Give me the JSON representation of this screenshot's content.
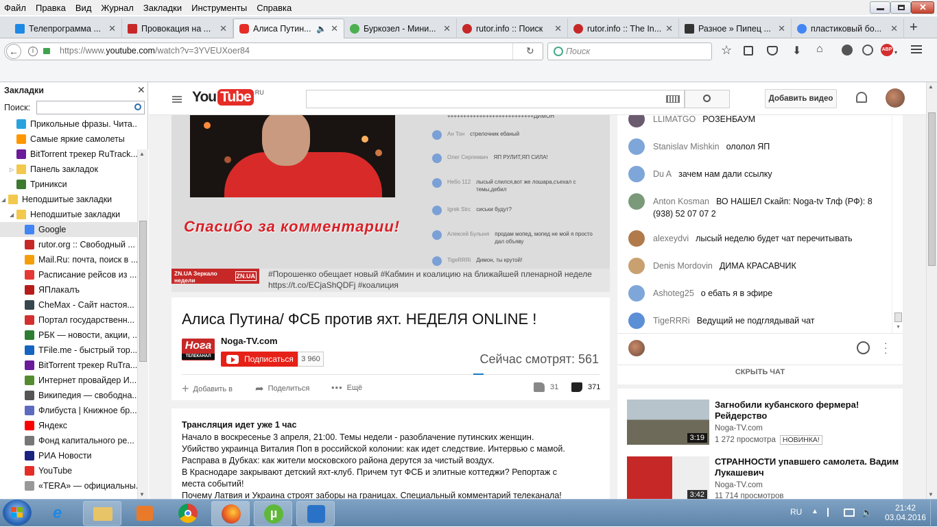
{
  "menu": [
    "Файл",
    "Правка",
    "Вид",
    "Журнал",
    "Закладки",
    "Инструменты",
    "Справка"
  ],
  "tabs": [
    {
      "label": "Телепрограмма ...",
      "favicon_color": "#1e88e5"
    },
    {
      "label": "Провокация на ...",
      "favicon_color": "#c62828"
    },
    {
      "label": "Алиса Путин...",
      "favicon_color": "#e52d27",
      "active": true
    },
    {
      "label": "Буркозел - Мини...",
      "favicon_color": "#4caf50"
    },
    {
      "label": "rutor.info :: Поиск",
      "favicon_color": "#c62828"
    },
    {
      "label": "rutor.info :: The In...",
      "favicon_color": "#c62828"
    },
    {
      "label": "Разное » Пипец ...",
      "favicon_color": "#333333"
    },
    {
      "label": "пластиковый бо...",
      "favicon_color": "#4285f4"
    }
  ],
  "url": {
    "prefix": "https://www.",
    "host": "youtube.com",
    "path": "/watch?v=3YVEUXoer84"
  },
  "search_placeholder": "Поиск",
  "sidebar": {
    "title": "Закладки",
    "search_label": "Поиск:",
    "items": [
      {
        "label": "Прикольные фразы. Чита...",
        "color": "#29a3e0",
        "indent": 24
      },
      {
        "label": "Самые яркие самолеты",
        "color": "#ff9800",
        "indent": 24
      },
      {
        "label": "BitTorrent трекер RuTrack...",
        "color": "#6a1b9a",
        "indent": 24
      },
      {
        "label": "Панель закладок",
        "color": "#f2c94c",
        "indent": 24,
        "folder": true
      },
      {
        "label": "Триникси",
        "color": "#3c7a2e",
        "indent": 24
      },
      {
        "label": "Неподшитые закладки",
        "color": "#f2c94c",
        "indent": 12,
        "folder": true
      },
      {
        "label": "Неподшитые закладки",
        "color": "#f2c94c",
        "indent": 24,
        "folder": true
      },
      {
        "label": "Google",
        "color": "#4285f4",
        "indent": 36,
        "selected": true
      },
      {
        "label": "rutor.org :: Свободный ...",
        "color": "#c62828",
        "indent": 36
      },
      {
        "label": "Mail.Ru: почта, поиск в ...",
        "color": "#f59e0b",
        "indent": 36
      },
      {
        "label": "Расписание рейсов из ...",
        "color": "#e53935",
        "indent": 36
      },
      {
        "label": "ЯПлакалъ",
        "color": "#b71c1c",
        "indent": 36
      },
      {
        "label": "CheMax - Сайт настоя...",
        "color": "#37474f",
        "indent": 36
      },
      {
        "label": "Портал государственн...",
        "color": "#d32f2f",
        "indent": 36
      },
      {
        "label": "РБК — новости, акции, ...",
        "color": "#2e7d32",
        "indent": 36
      },
      {
        "label": "TFile.me - быстрый тор...",
        "color": "#1565c0",
        "indent": 36
      },
      {
        "label": "BitTorrent трекер RuTra...",
        "color": "#6a1b9a",
        "indent": 36
      },
      {
        "label": "Интернет провайдер И...",
        "color": "#558b2f",
        "indent": 36
      },
      {
        "label": "Википедия — свободна...",
        "color": "#555555",
        "indent": 36
      },
      {
        "label": "Флибуста | Книжное бр...",
        "color": "#5c6bc0",
        "indent": 36
      },
      {
        "label": "Яндекс",
        "color": "#ff0000",
        "indent": 36
      },
      {
        "label": "Фонд капитального ре...",
        "color": "#777777",
        "indent": 36
      },
      {
        "label": "РИА Новости",
        "color": "#1a237e",
        "indent": 36
      },
      {
        "label": "YouTube",
        "color": "#e52d27",
        "indent": 36
      },
      {
        "label": "«TERA» — официальны...",
        "color": "#999999",
        "indent": 36
      }
    ]
  },
  "yt": {
    "logo_text": "You",
    "logo_tube": "Tube",
    "logo_region": "RU",
    "upload_label": "Добавить видео"
  },
  "video": {
    "overlay_banner": "Спасибо за комментарии!",
    "ticker_logo": "ZN.UA Зеркало недели",
    "ticker_logo_short": "ZN.UA",
    "ticker_line1": "#Порошенко обещает новый #Кабмин и коалицию на ближайшей пленарной неделе",
    "ticker_line2": "https://t.co/ECjaShQDFj #коалиция",
    "embedded_chat": [
      {
        "author": "",
        "text": "+++++++++++++++++++++++++++ДИМОН"
      },
      {
        "author": "Ан Тон",
        "text": "стрелочник ебаный"
      },
      {
        "author": "Олег Сергеевич",
        "text": "ЯП РУЛИТ,ЯП СИЛА!"
      },
      {
        "author": "Небо 112",
        "text": "лысый слился,вот же лошара,съехал с темы,дебил"
      },
      {
        "author": "Igrek Strc",
        "text": "сиськи будут?"
      },
      {
        "author": "Алексей Булыня",
        "text": "продам мопед, мопед не мой я просто дал объяву"
      },
      {
        "author": "TigeRRRi",
        "text": "Димон, ты крутой!"
      }
    ]
  },
  "info": {
    "title": "Алиса Путина/ ФСБ против яхт. НЕДЕЛЯ ONLINE !",
    "channel": "Noga-TV.com",
    "subscribe_label": "Подписаться",
    "subscribers": "3 960",
    "watching": "Сейчас смотрят: 561",
    "add_to": "Добавить в",
    "share": "Поделиться",
    "more": "Ещё",
    "likes": "31",
    "dislikes": "371"
  },
  "description": {
    "heading": "Трансляция идет уже 1 час",
    "lines": [
      "Начало в воскресенье 3 апреля, 21:00. Темы недели - разоблачение путинских женщин.",
      "Убийство украинца Виталия Поп в российской колонии: как идет следствие. Интервью с мамой.",
      "Расправа в Дубках: как жители московского района дерутся за чистый воздух.",
      "В Краснодаре закрывают детский яхт-клуб. Причем тут ФСБ и элитные коттеджи? Репортаж с",
      "места событий!",
      "Почему Латвия и Украина строят заборы на границах. Специальный комментарий телеканала!"
    ]
  },
  "live_chat": {
    "messages": [
      {
        "author": "LLIMATGO",
        "text": "РОЗЕНБАУМ",
        "avatar": "#6b5b6e"
      },
      {
        "author": "Stanislav Mishkin",
        "text": "ололол ЯП",
        "avatar": "#7ea6d8"
      },
      {
        "author": "Du A",
        "text": "зачем нам дали ссылку",
        "avatar": "#7ea6d8"
      },
      {
        "author": "Anton Kosman",
        "text": "ВО НАШЕЛ Скайп: Noga-tv Тлф (РФ): 8 (938) 52 07 07 2",
        "avatar": "#7a9a7a"
      },
      {
        "author": "alexeydvi",
        "text": "лысый неделю будет чат перечитывать",
        "avatar": "#b07a4a"
      },
      {
        "author": "Denis Mordovin",
        "text": "ДИМА КРАСАВЧИК",
        "avatar": "#c9a070"
      },
      {
        "author": "Ashoteg25",
        "text": "о ебать я в эфире",
        "avatar": "#7ea6d8"
      },
      {
        "author": "TigeRRRi",
        "text": "Ведущий не подглядывай чат",
        "avatar": "#5b8fd6"
      }
    ],
    "hide_chat": "СКРЫТЬ ЧАТ"
  },
  "related": [
    {
      "title": "Загнобили кубанского фермера! Рейдерство",
      "channel": "Noga-TV.com",
      "views": "1 272 просмотра",
      "badge": "НОВИНКА!",
      "duration": "3:19"
    },
    {
      "title": "СТРАННОСТИ упавшего самолета. Вадим Лукашевич",
      "channel": "Noga-TV.com",
      "views": "11 714 просмотров",
      "badge": "",
      "duration": "3:42"
    }
  ],
  "tray": {
    "lang": "RU",
    "time": "21:42",
    "date": "03.04.2016"
  }
}
